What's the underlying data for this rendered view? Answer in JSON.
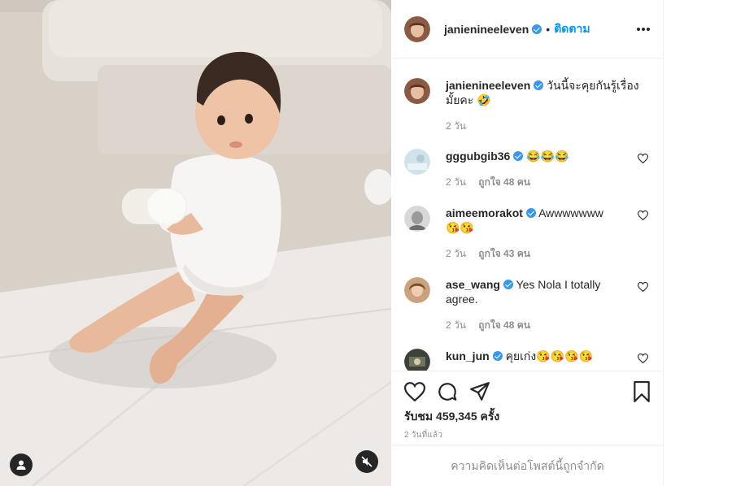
{
  "post": {
    "author": "janienineeleven",
    "dot": "•",
    "follow_label": "ติดตาม",
    "caption": "วันนี้จะคุยกันรู้เรื่องมั้ยคะ 🤣",
    "caption_time": "2 วัน"
  },
  "comments": [
    {
      "user": "gggubgib36",
      "text": "😂😂😂",
      "time": "2 วัน",
      "likes": "ถูกใจ 48 คน"
    },
    {
      "user": "aimeemorakot",
      "text": "Awwwwwww 😘😘",
      "time": "2 วัน",
      "likes": "ถูกใจ 43 คน"
    },
    {
      "user": "ase_wang",
      "text": "Yes Nola I totally agree.",
      "time": "2 วัน",
      "likes": "ถูกใจ 48 คน"
    },
    {
      "user": "kun_jun",
      "text": "คุยเก่ง😘😘😘😘",
      "time": "",
      "likes": ""
    }
  ],
  "stats": {
    "views": "รับชม 459,345 ครั้ง",
    "posted_ago": "2 วันที่แล้ว",
    "comments_limited": "ความคิดเห็นต่อโพสต์นี้ถูกจำกัด"
  },
  "icons": {
    "like": "heart-icon",
    "comment": "comment-icon",
    "share": "paper-plane-icon",
    "save": "bookmark-icon",
    "more": "more-options-icon",
    "user_tag": "user-icon",
    "mute": "speaker-muted-icon"
  },
  "colors": {
    "link": "#0095f6",
    "verified": "#3897f0",
    "muted_text": "#8e8e8e"
  }
}
